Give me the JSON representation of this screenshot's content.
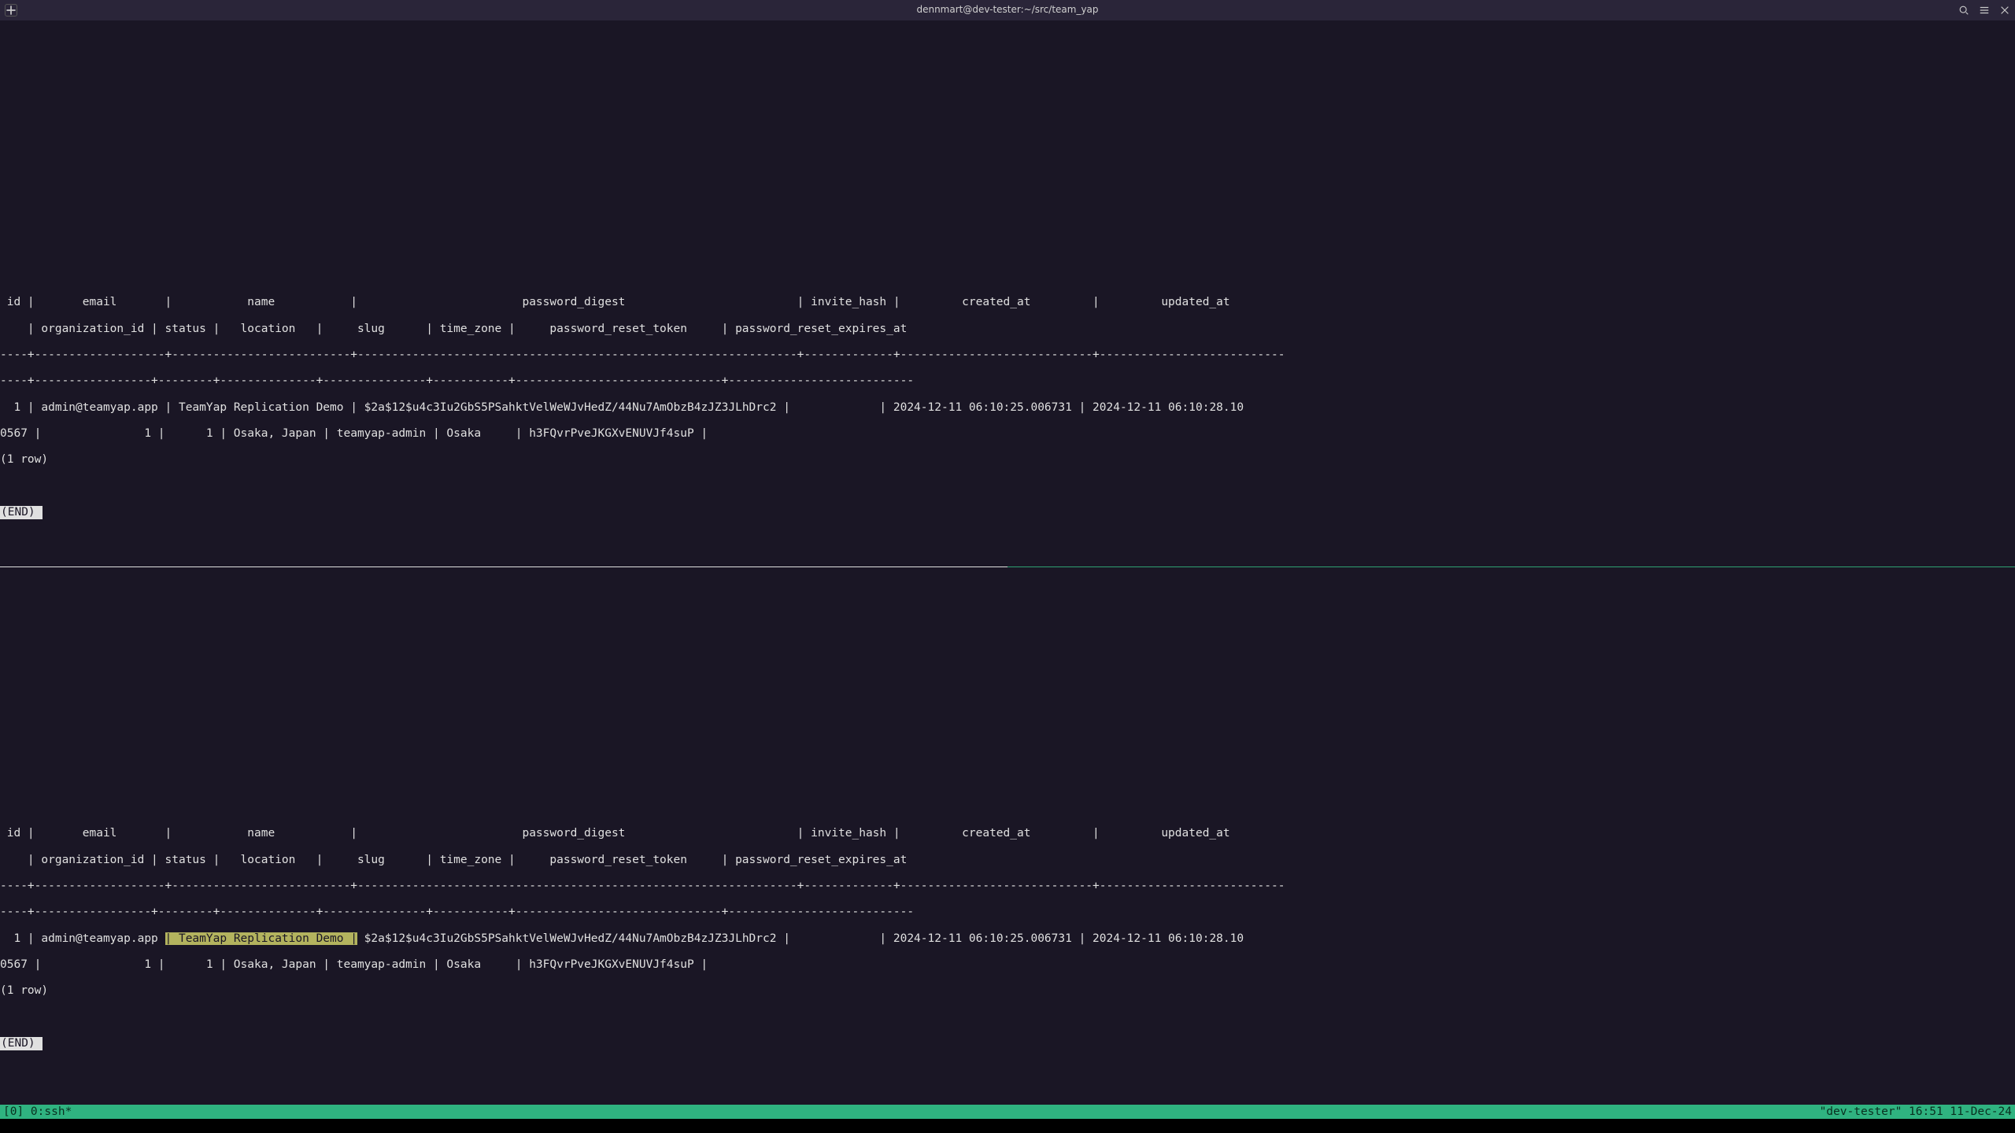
{
  "window": {
    "title": "dennmart@dev-tester:~/src/team_yap"
  },
  "panes": {
    "header_line1": " id |       email       |           name           |                        password_digest                         | invite_hash |         created_at         |         updated_at",
    "header_line2": "    | organization_id | status |   location   |     slug      | time_zone |     password_reset_token     | password_reset_expires_at",
    "separator1": "----+-------------------+--------------------------+----------------------------------------------------------------+-------------+----------------------------+---------------------------",
    "separator2": "----+-----------------+--------+--------------+---------------+-----------+------------------------------+---------------------------",
    "data_line1_a": "  1 | admin@teamyap.app ",
    "data_line1_b": "| TeamYap Replication Demo |",
    "data_line1_c": " $2a$12$u4c3Iu2GbS5PSahktVelWeWJvHedZ/44Nu7AmObzB4zJZ3JLhDrc2 |             | 2024-12-11 06:10:25.006731 | 2024-12-11 06:10:28.10",
    "data_line2": "0567 |               1 |      1 | Osaka, Japan | teamyap-admin | Osaka     | h3FQvrPveJKGXvENUVJf4suP |",
    "row_count": "(1 row)",
    "end_label": "(END)"
  },
  "tmux": {
    "left": "[0] 0:ssh*",
    "right": "\"dev-tester\" 16:51 11-Dec-24"
  }
}
